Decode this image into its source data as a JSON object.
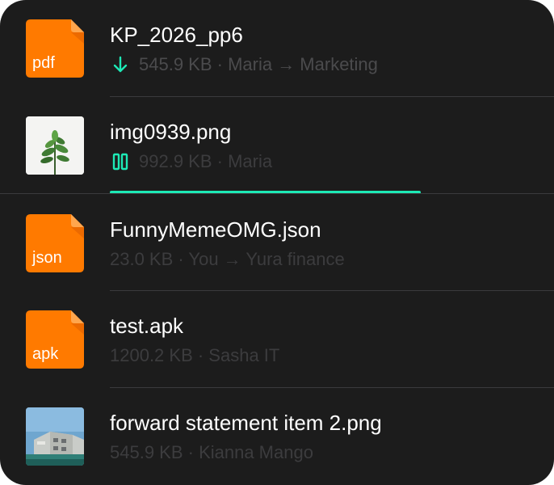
{
  "colors": {
    "panel_bg": "#1c1c1c",
    "accent": "#1de9b6",
    "file_icon_orange": "#ff7a00",
    "title_text": "#ffffff",
    "meta_text": "#4b4b4d"
  },
  "files": [
    {
      "title": "KP_2026_pp6",
      "meta": "545.9 KB · Maria → Marketing",
      "thumb": "doc-icon",
      "ext": "pdf",
      "status_icon": "download-arrow-icon"
    },
    {
      "title": "img0939.png",
      "meta": "992.9 KB · Maria",
      "thumb": "plant-photo",
      "status_icon": "pause-icon",
      "progress": 0.7
    },
    {
      "title": "FunnyMemeOMG.json",
      "meta": "23.0 KB · You → Yura finance",
      "thumb": "doc-icon",
      "ext": "json"
    },
    {
      "title": "test.apk",
      "meta": "1200.2 KB · Sasha IT",
      "thumb": "doc-icon",
      "ext": "apk"
    },
    {
      "title": "forward statement item 2.png",
      "meta": "545.9 KB · Kianna Mango",
      "thumb": "building-photo"
    }
  ]
}
